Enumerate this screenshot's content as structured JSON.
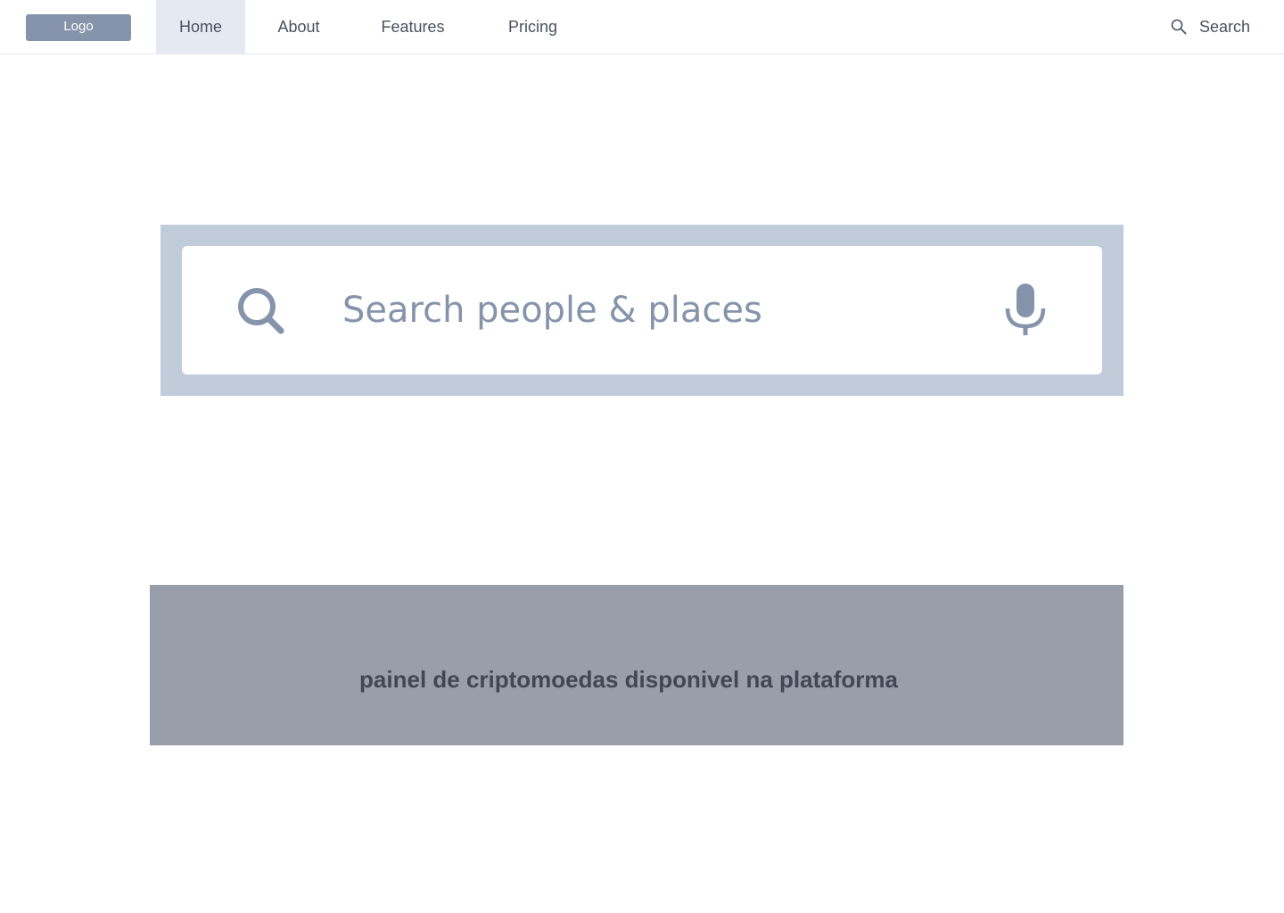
{
  "header": {
    "logo_label": "Logo",
    "nav": [
      {
        "label": "Home",
        "active": true
      },
      {
        "label": "About",
        "active": false
      },
      {
        "label": "Features",
        "active": false
      },
      {
        "label": "Pricing",
        "active": false
      }
    ],
    "search_label": "Search"
  },
  "search": {
    "placeholder": "Search people & places",
    "value": ""
  },
  "banner": {
    "text": "painel de criptomoedas disponivel na plataforma"
  },
  "colors": {
    "logo_bg": "#8594aa",
    "nav_active_bg": "#e5e9f2",
    "search_frame": "#c1ccda",
    "icon": "#8594aa",
    "banner_bg": "#989eaa",
    "banner_text": "#404854"
  },
  "icons": {
    "top_search": "search-icon",
    "search_box": "search-icon",
    "voice": "microphone-icon"
  }
}
